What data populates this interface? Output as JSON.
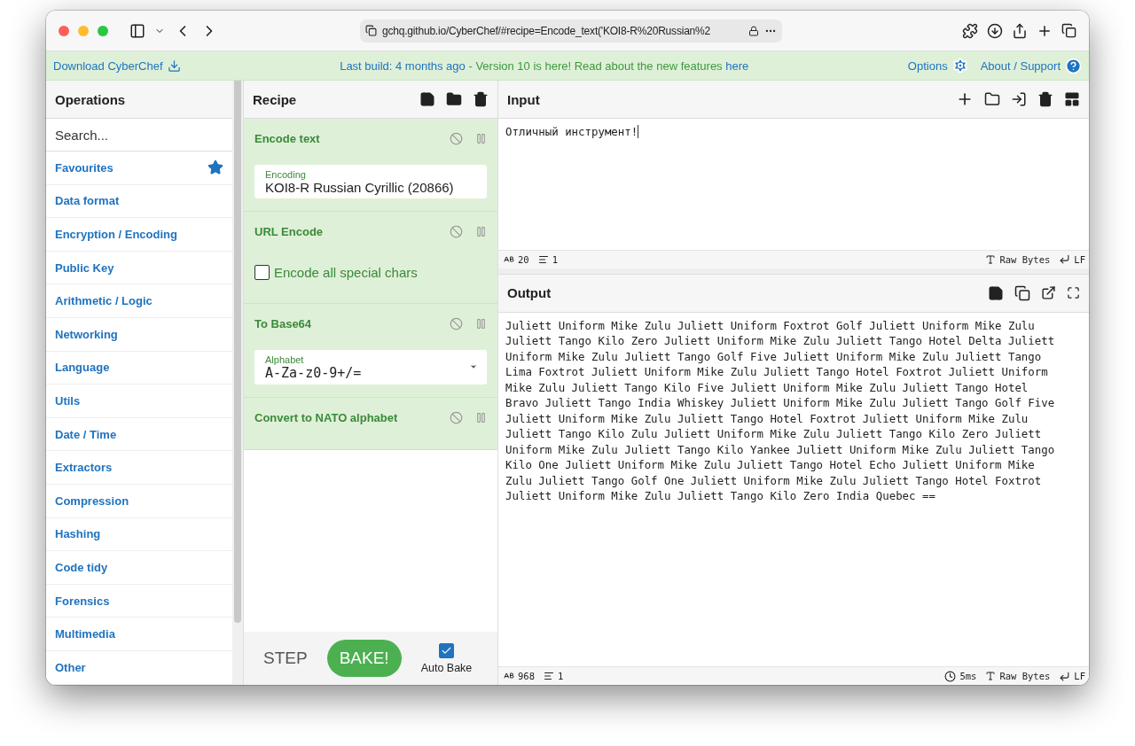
{
  "browser": {
    "url": "gchq.github.io/CyberChef/#recipe=Encode_text('KOI8-R%20Russian%2"
  },
  "banner": {
    "download": "Download CyberChef",
    "build": "Last build: 4 months ago",
    "separator": " - ",
    "news": "Version 10 is here! Read about the new features ",
    "news_link": "here",
    "options": "Options",
    "about": "About / Support"
  },
  "operations": {
    "title": "Operations",
    "search": {
      "placeholder": "Search..."
    },
    "items": [
      {
        "label": "Favourites",
        "kind": "favourite"
      },
      {
        "label": "Data format",
        "kind": "category"
      },
      {
        "label": "Encryption / Encoding",
        "kind": "category"
      },
      {
        "label": "Public Key",
        "kind": "category"
      },
      {
        "label": "Arithmetic / Logic",
        "kind": "category"
      },
      {
        "label": "Networking",
        "kind": "category"
      },
      {
        "label": "Language",
        "kind": "category"
      },
      {
        "label": "Utils",
        "kind": "category"
      },
      {
        "label": "Date / Time",
        "kind": "category"
      },
      {
        "label": "Extractors",
        "kind": "category"
      },
      {
        "label": "Compression",
        "kind": "category"
      },
      {
        "label": "Hashing",
        "kind": "category"
      },
      {
        "label": "Code tidy",
        "kind": "category"
      },
      {
        "label": "Forensics",
        "kind": "category"
      },
      {
        "label": "Multimedia",
        "kind": "category"
      },
      {
        "label": "Other",
        "kind": "category"
      }
    ]
  },
  "recipe": {
    "title": "Recipe",
    "steps": [
      {
        "name": "Encode text",
        "args": [
          {
            "kind": "field",
            "label": "Encoding",
            "value": "KOI8-R Russian Cyrillic (20866)",
            "dropdown": false,
            "mono": false
          }
        ]
      },
      {
        "name": "URL Encode",
        "args": [
          {
            "kind": "checkbox",
            "label": "Encode all special chars",
            "checked": false
          }
        ]
      },
      {
        "name": "To Base64",
        "args": [
          {
            "kind": "field",
            "label": "Alphabet",
            "value": "A-Za-z0-9+/=",
            "dropdown": true,
            "mono": true
          }
        ]
      },
      {
        "name": "Convert to NATO alphabet"
      }
    ],
    "step": "STEP",
    "bake": "BAKE!",
    "auto_bake": {
      "label": "Auto Bake",
      "checked": true
    }
  },
  "input": {
    "title": "Input",
    "text": "Отличный инструмент!",
    "status": {
      "length": "20",
      "lines": "1",
      "encoding": "Raw Bytes",
      "eol": "LF"
    }
  },
  "output": {
    "title": "Output",
    "lines": [
      "Juliett Uniform Mike Zulu Juliett Uniform Foxtrot Golf Juliett Uniform Mike Zulu",
      "Juliett Tango Kilo Zero Juliett Uniform Mike Zulu Juliett Tango Hotel Delta Juliett",
      "Uniform Mike Zulu Juliett Tango Golf Five Juliett Uniform Mike Zulu Juliett Tango",
      "Lima Foxtrot Juliett Uniform Mike Zulu Juliett Tango Hotel Foxtrot Juliett Uniform",
      "Mike Zulu Juliett Tango Kilo Five Juliett Uniform Mike Zulu Juliett Tango Hotel",
      "Bravo Juliett Tango India Whiskey Juliett Uniform Mike Zulu Juliett Tango Golf Five",
      "Juliett Uniform Mike Zulu Juliett Tango Hotel Foxtrot Juliett Uniform Mike Zulu",
      "Juliett Tango Kilo Zulu Juliett Uniform Mike Zulu Juliett Tango Kilo Zero Juliett",
      "Uniform Mike Zulu Juliett Tango Kilo Yankee Juliett Uniform Mike Zulu Juliett Tango",
      "Kilo One Juliett Uniform Mike Zulu Juliett Tango Hotel Echo Juliett Uniform Mike",
      "Zulu Juliett Tango Golf One Juliett Uniform Mike Zulu Juliett Tango Hotel Foxtrot",
      "Juliett Uniform Mike Zulu Juliett Tango Kilo Zero India Quebec =="
    ],
    "status": {
      "length": "968",
      "lines": "1",
      "time": "5ms",
      "encoding": "Raw Bytes",
      "eol": "LF"
    }
  }
}
